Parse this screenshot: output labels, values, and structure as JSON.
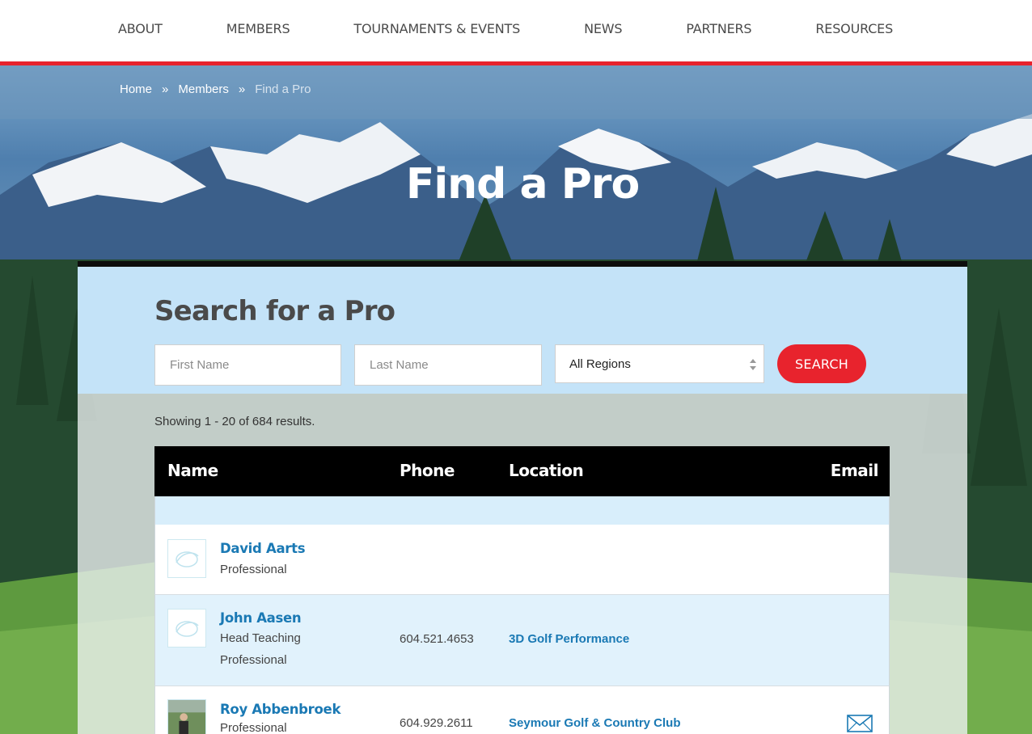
{
  "nav": {
    "items": [
      {
        "label": "ABOUT"
      },
      {
        "label": "MEMBERS"
      },
      {
        "label": "TOURNAMENTS & EVENTS"
      },
      {
        "label": "NEWS"
      },
      {
        "label": "PARTNERS"
      },
      {
        "label": "RESOURCES"
      }
    ],
    "accent_color": "#e8232d"
  },
  "breadcrumb": {
    "home": "Home",
    "sep1": "»",
    "members": "Members",
    "sep2": "»",
    "current": "Find a Pro"
  },
  "page": {
    "title": "Find a Pro"
  },
  "search": {
    "title": "Search for a Pro",
    "first_name_placeholder": "First Name",
    "last_name_placeholder": "Last Name",
    "region_selected": "All Regions",
    "button_label": "SEARCH",
    "button_color": "#e8232d"
  },
  "results": {
    "summary": "Showing 1 - 20 of 684 results.",
    "columns": {
      "name": "Name",
      "phone": "Phone",
      "location": "Location",
      "email": "Email"
    },
    "rows": [
      {
        "name": "David Aarts",
        "title": "Professional",
        "phone": "",
        "location": "",
        "has_email": false,
        "avatar": "logo-placeholder"
      },
      {
        "name": "John Aasen",
        "title": "Head Teaching Professional",
        "phone": "604.521.4653",
        "location": "3D Golf Performance",
        "has_email": false,
        "avatar": "logo-placeholder"
      },
      {
        "name": "Roy Abbenbroek",
        "title": "Professional",
        "phone": "604.929.2611",
        "location": "Seymour Golf & Country Club",
        "has_email": true,
        "avatar": "photo"
      }
    ],
    "link_color": "#1a79b4"
  }
}
